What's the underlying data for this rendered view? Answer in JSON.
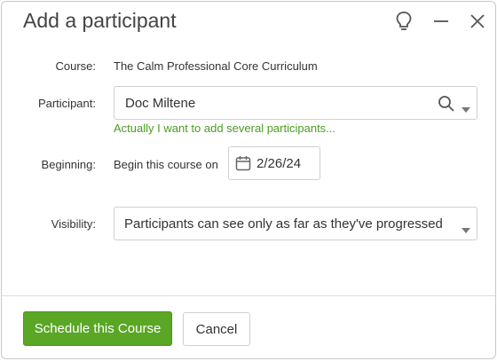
{
  "dialog": {
    "title": "Add a participant",
    "icons": {
      "hint": "lightbulb-icon",
      "minimize": "minimize-icon",
      "close": "close-icon"
    }
  },
  "form": {
    "course": {
      "label": "Course:",
      "value": "The Calm Professional Core Curriculum"
    },
    "participant": {
      "label": "Participant:",
      "value": "Doc Miltene",
      "link": "Actually I want to add several participants..."
    },
    "beginning": {
      "label": "Beginning:",
      "prefix": "Begin this course on",
      "date": "2/26/24"
    },
    "visibility": {
      "label": "Visibility:",
      "selected": "Participants can see only as far as they've progressed"
    }
  },
  "footer": {
    "primary_label": "Schedule this Course",
    "cancel_label": "Cancel"
  },
  "colors": {
    "accent": "#5aa625",
    "link": "#4a9d1f"
  }
}
